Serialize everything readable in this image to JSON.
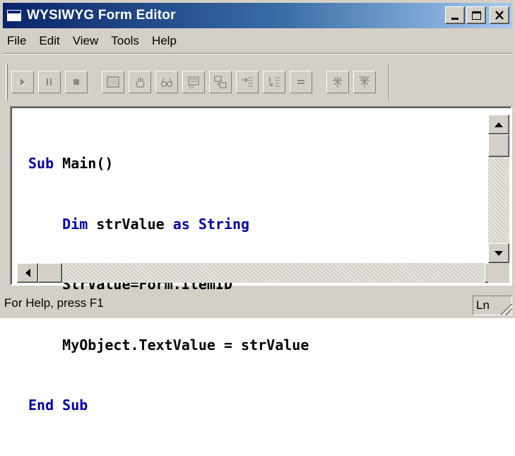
{
  "window": {
    "title": "WYSIWYG Form Editor",
    "title_buttons": [
      "minimize",
      "maximize",
      "close"
    ],
    "title_bar_colors": [
      "#0a246a",
      "#a6caf0"
    ]
  },
  "menu": {
    "items": [
      "File",
      "Edit",
      "View",
      "Tools",
      "Help"
    ]
  },
  "toolbar": {
    "buttons": [
      {
        "icon": "play-icon",
        "enabled": false
      },
      {
        "icon": "pause-icon",
        "enabled": false
      },
      {
        "icon": "stop-icon",
        "enabled": false
      },
      {
        "icon": "form-icon",
        "enabled": false
      },
      {
        "icon": "hand-icon",
        "enabled": false
      },
      {
        "icon": "glasses-icon",
        "enabled": false
      },
      {
        "icon": "watch-icon",
        "enabled": false
      },
      {
        "icon": "call-stack-icon",
        "enabled": false
      },
      {
        "icon": "step-into-icon",
        "enabled": false
      },
      {
        "icon": "step-over-icon",
        "enabled": false
      },
      {
        "icon": "equals-icon",
        "enabled": false
      },
      {
        "icon": "breakpoint-icon",
        "enabled": false
      },
      {
        "icon": "clear-breakpoints-icon",
        "enabled": false
      }
    ]
  },
  "editor": {
    "keyword_color": "#0000a8",
    "lines": [
      {
        "keyword1": "Sub",
        "text": " Main()",
        "keyword2": "",
        "text2": "",
        "indent": ""
      },
      {
        "keyword1": "Dim",
        "text": " strValue ",
        "keyword2": "as String",
        "text2": "",
        "indent": "    "
      },
      {
        "keyword1": "",
        "text": "StrValue=Form.ItemID",
        "keyword2": "",
        "text2": "",
        "indent": "    "
      },
      {
        "keyword1": "",
        "text": "MyObject.TextValue = strValue",
        "keyword2": "",
        "text2": "",
        "indent": "    "
      },
      {
        "keyword1": "End Sub",
        "text": "",
        "keyword2": "",
        "text2": "",
        "indent": ""
      }
    ]
  },
  "status": {
    "help_text": "For Help, press F1",
    "pane_text": "Ln"
  }
}
